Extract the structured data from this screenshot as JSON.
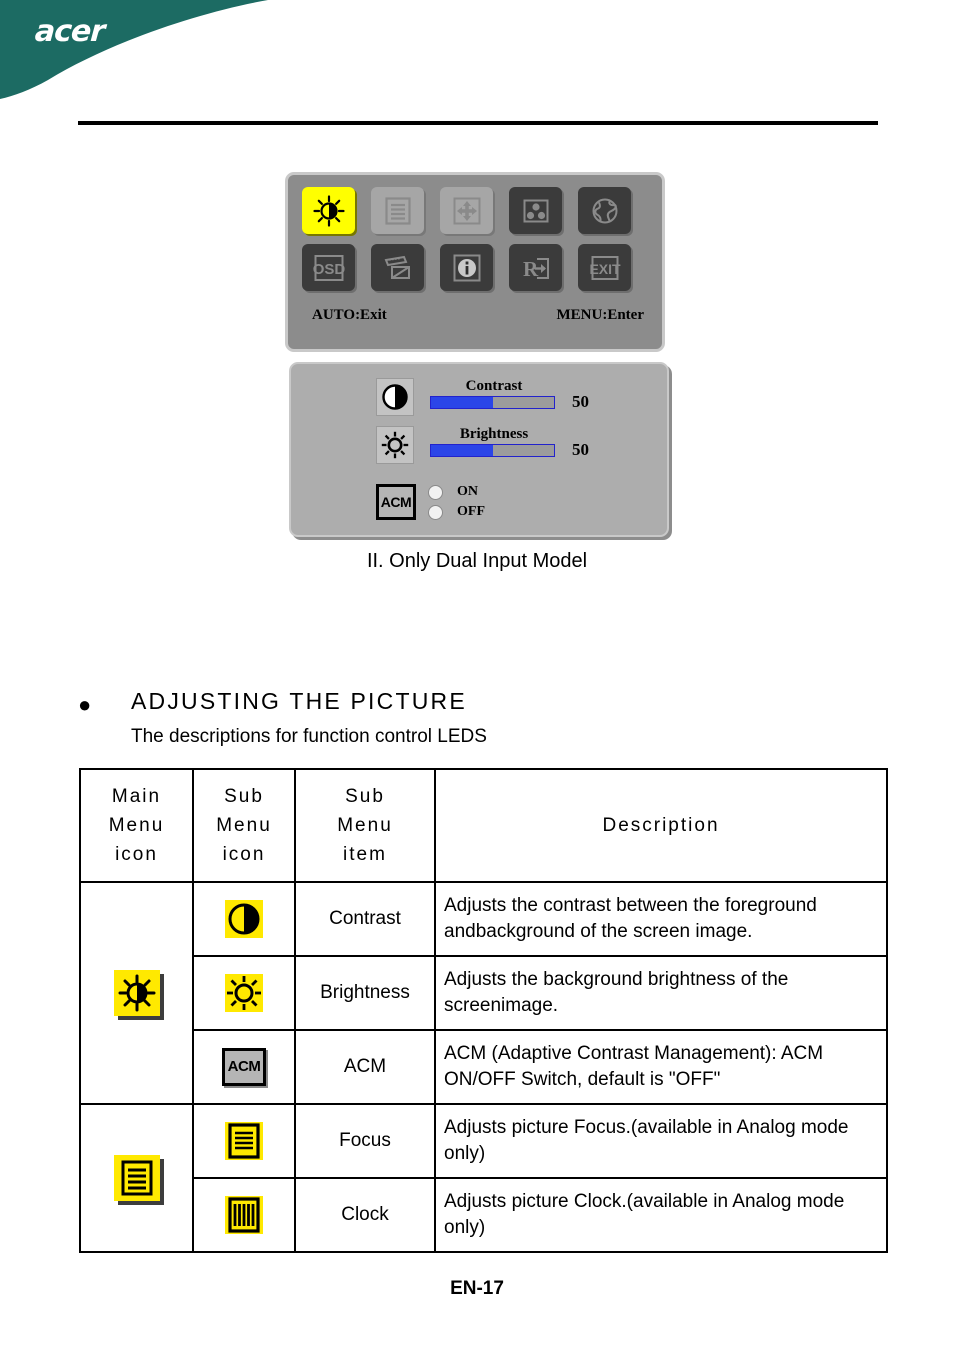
{
  "header": {
    "logo_text": "acer",
    "brand_color": "#1c6b63"
  },
  "figure": {
    "osd_menu": {
      "row1_icons": [
        "brightness-contrast-icon",
        "focus-clock-icon",
        "position-icon",
        "color-icon",
        "language-globe-icon"
      ],
      "row2_icons": [
        "osd-icon",
        "input-source-icon",
        "information-icon",
        "reset-icon",
        "exit-icon"
      ],
      "selected_index": 0,
      "left_hint": "AUTO:Exit",
      "right_hint": "MENU:Enter"
    },
    "osd_panel": {
      "contrast": {
        "icon": "contrast-icon",
        "label": "Contrast",
        "value": "50",
        "percent": 50
      },
      "brightness": {
        "icon": "brightness-icon",
        "label": "Brightness",
        "value": "50",
        "percent": 50
      },
      "acm": {
        "icon_label": "ACM",
        "options": [
          {
            "label": "ON",
            "selected": false
          },
          {
            "label": "OFF",
            "selected": false
          }
        ]
      }
    },
    "caption": "II. Only Dual Input Model"
  },
  "section": {
    "bullet": "●",
    "title": "ADJUSTING  THE  PICTURE",
    "subtitle": "The descriptions for function control LEDS"
  },
  "table": {
    "headers": {
      "col1": "Main\nMenu\nicon",
      "col1_lines": [
        "Main",
        "Menu",
        "icon"
      ],
      "col2_lines": [
        "Sub",
        "Menu",
        "icon"
      ],
      "col3_lines": [
        "Sub",
        "Menu",
        "item"
      ],
      "col4": "Description"
    },
    "groups": [
      {
        "main_icon": "brightness-contrast-icon",
        "rows": [
          {
            "sub_icon": "contrast-icon",
            "item": "Contrast",
            "description": "Adjusts the contrast between the foreground andbackground of the screen image."
          },
          {
            "sub_icon": "brightness-icon",
            "item": "Brightness",
            "description": "Adjusts the background brightness of the screenimage."
          },
          {
            "sub_icon": "acm-icon",
            "item": "ACM",
            "description": "ACM (Adaptive Contrast Management): ACM ON/OFF Switch, default  is \"OFF\""
          }
        ]
      },
      {
        "main_icon": "focus-clock-icon",
        "rows": [
          {
            "sub_icon": "focus-icon",
            "item": "Focus",
            "description": "Adjusts picture Focus.(available in Analog mode only)"
          },
          {
            "sub_icon": "clock-icon",
            "item": "Clock",
            "description": "Adjusts picture Clock.(available in Analog mode only)"
          }
        ]
      }
    ]
  },
  "footer": {
    "page_label": "EN-17"
  }
}
